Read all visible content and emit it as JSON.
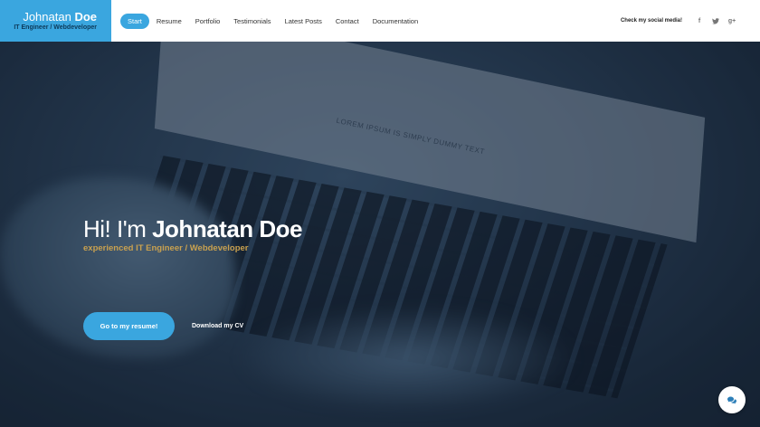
{
  "brand": {
    "first_name": "Johnatan",
    "last_name": "Doe",
    "subtitle": "IT Engineer / Webdeveloper"
  },
  "nav": {
    "items": [
      {
        "label": "Start",
        "active": true
      },
      {
        "label": "Resume",
        "active": false
      },
      {
        "label": "Portfolio",
        "active": false
      },
      {
        "label": "Testimonials",
        "active": false
      },
      {
        "label": "Latest Posts",
        "active": false
      },
      {
        "label": "Contact",
        "active": false
      },
      {
        "label": "Documentation",
        "active": false
      }
    ]
  },
  "social": {
    "label": "Check my social media!",
    "icons": [
      "facebook-icon",
      "twitter-icon",
      "google-plus-icon"
    ],
    "glyphs": [
      "f",
      "t",
      "g+"
    ]
  },
  "hero": {
    "screen_text": "LOREM IPSUM IS SIMPLY DUMMY TEXT",
    "greeting_prefix": "Hi! I'm",
    "name": "Johnatan Doe",
    "tagline": "experienced IT Engineer / Webdeveloper",
    "primary_button": "Go to my resume!",
    "secondary_link": "Download my CV"
  },
  "colors": {
    "accent": "#3aa6df",
    "tagline": "#c9a14f",
    "header_bg": "#ffffff"
  },
  "chat": {
    "icon": "chat-bubbles-icon"
  }
}
